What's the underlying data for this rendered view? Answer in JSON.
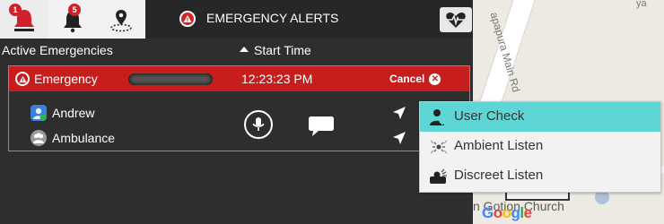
{
  "header": {
    "title": "EMERGENCY ALERTS",
    "tabs": [
      {
        "icon": "alert-bell-icon",
        "badge": "1"
      },
      {
        "icon": "notification-bell-icon",
        "badge": "5"
      },
      {
        "icon": "location-pin-icon",
        "badge": ""
      }
    ],
    "heart_button_icon": "heartbeat-icon"
  },
  "columns": {
    "active": "Active Emergencies",
    "start_time": "Start Time"
  },
  "emergency": {
    "label": "Emergency",
    "start_time": "12:23:23 PM",
    "cancel_label": "Cancel"
  },
  "responders": [
    {
      "name": "Andrew",
      "icon": "user-avatar-icon"
    },
    {
      "name": "Ambulance",
      "icon": "group-icon"
    }
  ],
  "menu": {
    "items": [
      {
        "label": "User Check",
        "icon": "user-check-icon",
        "active": true
      },
      {
        "label": "Ambient Listen",
        "icon": "ambient-listen-icon",
        "active": false
      },
      {
        "label": "Discreet Listen",
        "icon": "discreet-listen-icon",
        "active": false
      }
    ]
  },
  "map": {
    "road_label": "apapura Main Rd",
    "corner_label": "ya",
    "place_label": "n  Gotion Church",
    "logo_text": "Google"
  },
  "colors": {
    "emergency_red": "#c61d1d",
    "menu_highlight": "#5fd6d6",
    "badge_red": "#d0202a"
  }
}
